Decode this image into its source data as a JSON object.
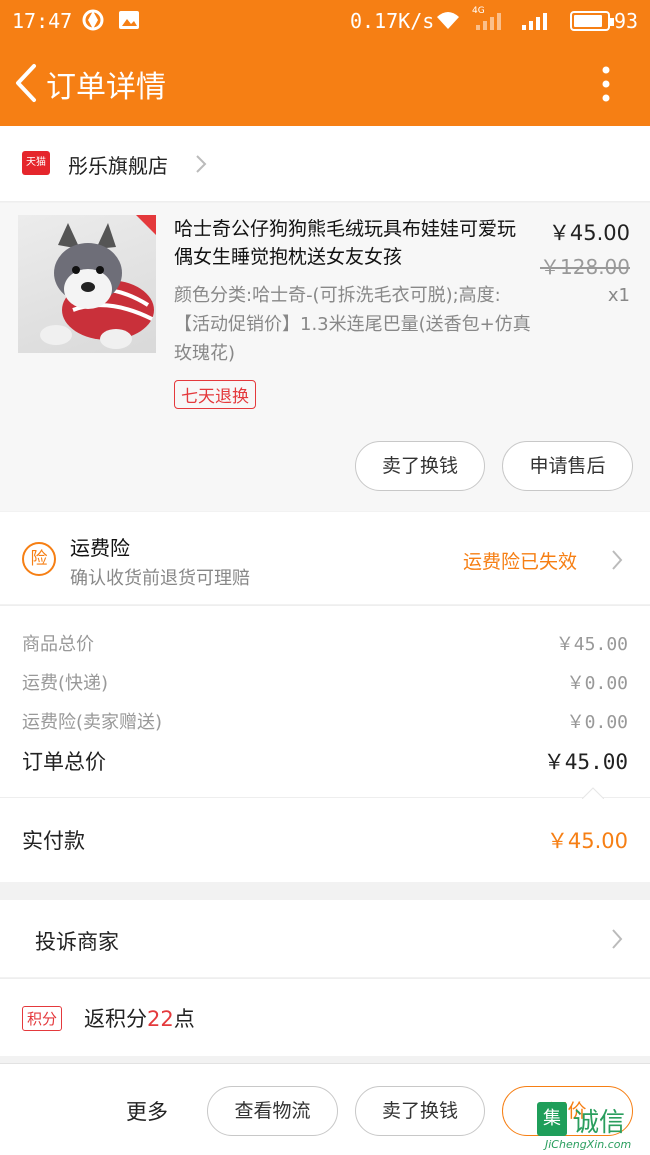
{
  "status_bar": {
    "time": "17:47",
    "net_speed": "0.17K/s",
    "network_type": "4G",
    "battery": "93"
  },
  "nav": {
    "title": "订单详情",
    "back_icon": "back-chevron-icon",
    "more_icon": "more-vertical-icon"
  },
  "shop": {
    "platform_badge": "天猫",
    "name": "彤乐旗舰店"
  },
  "item": {
    "name": "哈士奇公仔狗狗熊毛绒玩具布娃娃可爱玩偶女生睡觉抱枕送女友女孩",
    "price": "￥45.00",
    "original_price": "￥128.00",
    "quantity": "x1",
    "sku": "颜色分类:哈士奇-(可拆洗毛衣可脱);高度:【活动促销价】1.3米连尾巴量(送香包+仿真玫瑰花)",
    "return_tag": "七天退换",
    "btn_refund": "卖了换钱",
    "btn_after_sale": "申请售后"
  },
  "insurance": {
    "badge": "险",
    "title": "运费险",
    "subtitle": "确认收货前退货可理赔",
    "status": "运费险已失效"
  },
  "summary": {
    "rows": [
      {
        "label": "商品总价",
        "value": "￥45.00"
      },
      {
        "label": "运费(快递)",
        "value": "￥0.00"
      },
      {
        "label": "运费险(卖家赠送)",
        "value": "￥0.00"
      }
    ],
    "total_label": "订单总价",
    "total_value": "￥45.00"
  },
  "payment": {
    "label": "实付款",
    "value": "￥45.00"
  },
  "complaint": {
    "label": "投诉商家"
  },
  "points": {
    "badge": "积分",
    "prefix": "返积分",
    "count": "22",
    "suffix": "点"
  },
  "bottom_bar": {
    "more": "更多",
    "logistics": "查看物流",
    "resell": "卖了换钱",
    "review": "评价"
  },
  "watermark": {
    "badge": "集",
    "cn": "诚信",
    "en": "JiChengXin.com"
  },
  "colors": {
    "brand_orange": "#f67f14",
    "tmall_red": "#e5262c",
    "accent_red": "#e4393c"
  }
}
